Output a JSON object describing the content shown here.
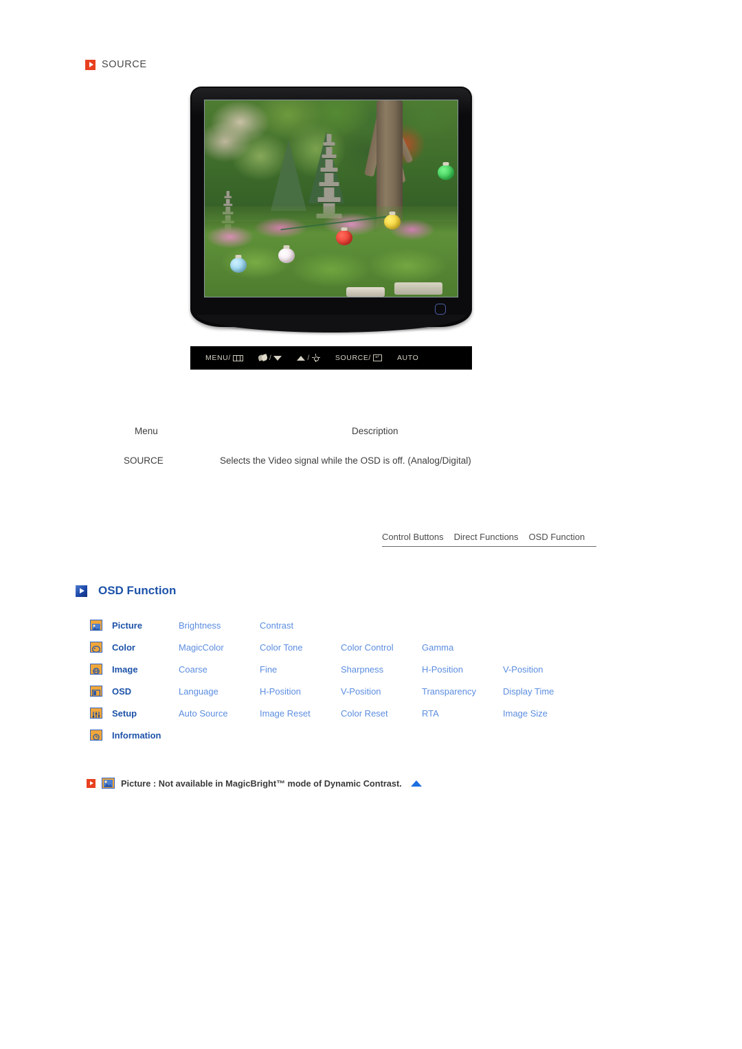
{
  "source_section": {
    "bullet_icon": "red-play-arrow-icon",
    "title": "SOURCE"
  },
  "monitor": {
    "screen_image_alt": "korean-garden-with-stone-pagoda-and-paper-lanterns",
    "power_button_label": "power-button",
    "control_buttons": [
      {
        "label": "MENU/",
        "icon": "menu-bars-icon"
      },
      {
        "label": "",
        "icon": "magicbright-icon",
        "separator": "/",
        "icon2": "triangle-down-icon"
      },
      {
        "label": "",
        "icon": "triangle-up-icon",
        "separator": "/",
        "icon2": "brightness-sun-icon"
      },
      {
        "label": "SOURCE/",
        "icon": "enter-key-icon"
      },
      {
        "label": "AUTO",
        "icon": ""
      }
    ],
    "control_labels": {
      "menu": "MENU/",
      "source": "SOURCE/",
      "auto": "AUTO",
      "enter_glyph": "↵"
    }
  },
  "description_table": {
    "headers": {
      "menu": "Menu",
      "description": "Description"
    },
    "rows": [
      {
        "menu": "SOURCE",
        "description": "Selects the Video signal while the OSD is off. (Analog/Digital)"
      }
    ]
  },
  "tabs": [
    {
      "label": "Control Buttons"
    },
    {
      "label": "Direct Functions"
    },
    {
      "label": "OSD Function"
    }
  ],
  "osd_function": {
    "bullet_icon": "blue-play-arrow-icon",
    "heading": "OSD Function",
    "rows": [
      {
        "icon": "picture-icon",
        "category": "Picture",
        "items": [
          "Brightness",
          "Contrast"
        ]
      },
      {
        "icon": "color-palette-icon",
        "category": "Color",
        "items": [
          "MagicColor",
          "Color Tone",
          "Color Control",
          "Gamma"
        ]
      },
      {
        "icon": "image-globe-icon",
        "category": "Image",
        "items": [
          "Coarse",
          "Fine",
          "Sharpness",
          "H-Position",
          "V-Position"
        ]
      },
      {
        "icon": "osd-window-icon",
        "category": "OSD",
        "items": [
          "Language",
          "H-Position",
          "V-Position",
          "Transparency",
          "Display Time"
        ]
      },
      {
        "icon": "setup-sliders-icon",
        "category": "Setup",
        "items": [
          "Auto Source",
          "Image Reset",
          "Color Reset",
          "RTA",
          "Image Size"
        ]
      },
      {
        "icon": "information-clock-icon",
        "category": "Information",
        "items": []
      }
    ]
  },
  "footnote": {
    "bullet_icon": "red-play-arrow-icon",
    "badge_icon": "picture-icon",
    "text": "Picture : Not available in MagicBright™ mode of Dynamic Contrast.",
    "top_arrow_icon": "blue-triangle-up-icon"
  },
  "colors": {
    "accent_red": "#e8401f",
    "accent_blue": "#1d52a8",
    "link_blue": "#5b8de0",
    "icon_orange": "#f0a63a",
    "icon_border_blue": "#2f62c4",
    "text_gray": "#3d3d3d",
    "bezel_black": "#0b0b0d"
  }
}
